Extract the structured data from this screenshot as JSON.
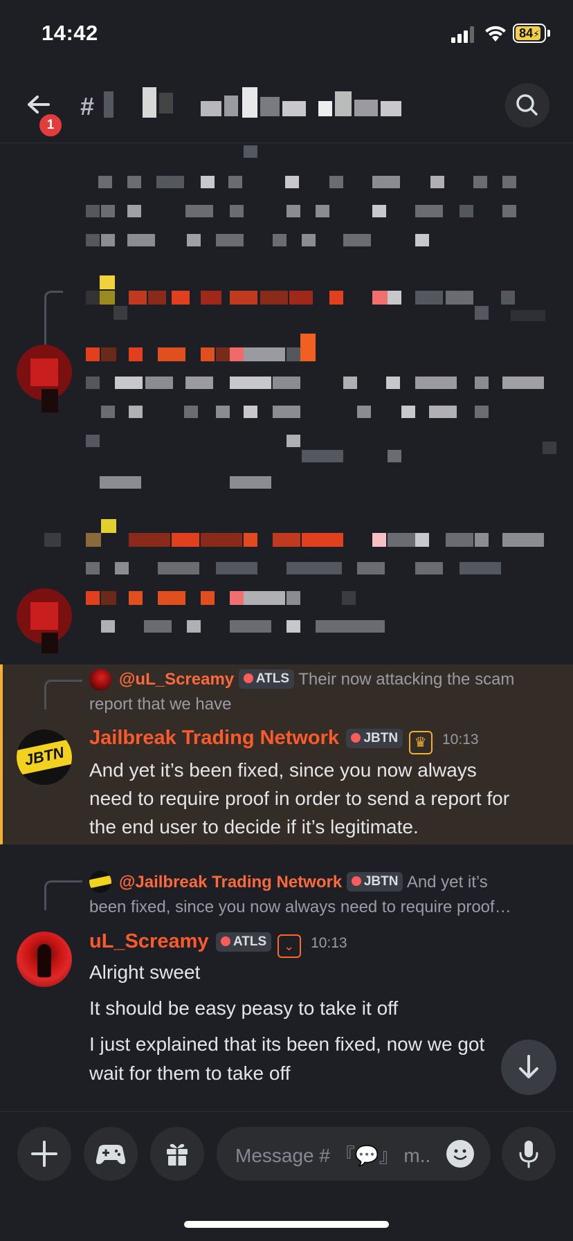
{
  "status_bar": {
    "time": "14:42",
    "battery": "84"
  },
  "header": {
    "notification_count": "1",
    "hash": "#"
  },
  "colors": {
    "background": "#1e1f24",
    "highlight": "#342c26",
    "highlight_bar": "#f0b232",
    "author": "#ff5a2b",
    "tag_bg": "#3b3d44"
  },
  "messages": [
    {
      "reply": {
        "mention": "@uL_Screamy",
        "tag": "ATLS",
        "preview_line1": "Their now attacking the scam",
        "preview_line2": "report that we have"
      },
      "author": "Jailbreak Trading Network",
      "tag": "JBTN",
      "avatar_text": "JBTN",
      "time": "10:13",
      "lines": [
        "And yet it’s been fixed, since you now always",
        "need to require proof in order to send a report for",
        "the end user to decide if it’s legitimate."
      ],
      "highlighted": true
    },
    {
      "reply": {
        "mention": "@Jailbreak Trading Network",
        "tag": "JBTN",
        "preview_line1": "And yet it’s",
        "preview_line2": "been fixed, since you now always need to require proof…"
      },
      "author": "uL_Screamy",
      "tag": "ATLS",
      "time": "10:13",
      "lines": [
        "Alright sweet",
        "It should be easy peasy to take it off",
        "I just explained that its been fixed, now we got",
        "wait for them to take off"
      ],
      "highlighted": false
    }
  ],
  "composer": {
    "placeholder": "Message # 『💬』 m.."
  },
  "icons": [
    "back-arrow-icon",
    "hash-icon",
    "search-icon",
    "plus-icon",
    "gamepad-icon",
    "gift-icon",
    "emoji-icon",
    "microphone-icon",
    "arrow-down-icon",
    "crown-icon",
    "shield-chevron-icon"
  ]
}
